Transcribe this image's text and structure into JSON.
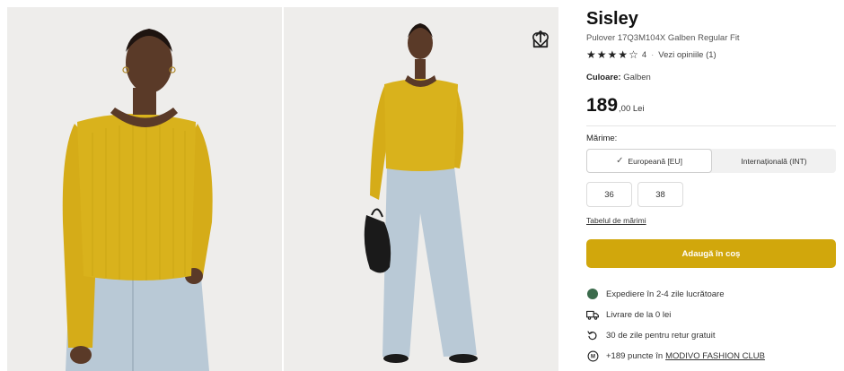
{
  "product": {
    "brand": "Sisley",
    "name": "Pulover 17Q3M104X Galben Regular Fit",
    "rating": 4,
    "rating_text": "4",
    "reviews_link": "Vezi opiniile (1)",
    "color_label": "Culoare:",
    "color_value": "Galben",
    "price_main": "189",
    "price_rest": ",00 Lei"
  },
  "size": {
    "label": "Mărime:",
    "tabs": [
      {
        "label": "Europeană [EU]",
        "active": true
      },
      {
        "label": "Internațională (INT)",
        "active": false
      }
    ],
    "options": [
      "36",
      "38"
    ],
    "table_link": "Tabelul de mărimi"
  },
  "cart": {
    "add_label": "Adaugă în coș"
  },
  "benefits": [
    {
      "icon": "status-dot-icon",
      "text": "Expediere în 2-4 zile lucrătoare"
    },
    {
      "icon": "truck-icon",
      "text": "Livrare de la 0 lei"
    },
    {
      "icon": "return-icon",
      "text": "30 de zile pentru retur gratuit"
    },
    {
      "icon": "club-badge-icon",
      "text": "+189 puncte în",
      "link": "MODIVO FASHION CLUB"
    }
  ],
  "gallery": {
    "actions": [
      "heart-icon",
      "share-icon"
    ]
  },
  "colors": {
    "accent": "#d1a70c",
    "sweater": "#d9b21c",
    "jeans": "#b8c9d6",
    "status_dot": "#3b6b4c"
  }
}
